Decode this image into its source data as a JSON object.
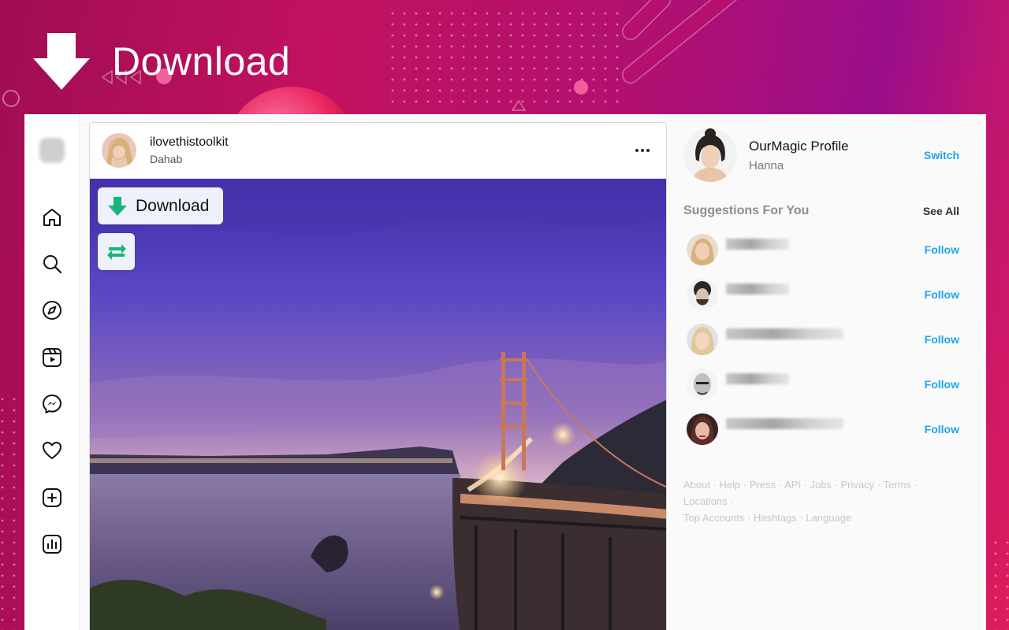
{
  "hero": {
    "title": "Download"
  },
  "sidebar": {
    "items": [
      {
        "name": "home-icon"
      },
      {
        "name": "search-icon"
      },
      {
        "name": "explore-icon"
      },
      {
        "name": "reels-icon"
      },
      {
        "name": "messenger-icon"
      },
      {
        "name": "heart-icon"
      },
      {
        "name": "create-icon"
      },
      {
        "name": "insights-icon"
      }
    ]
  },
  "post": {
    "username": "ilovethistoolkit",
    "location": "Dahab",
    "download_label": "Download"
  },
  "profile": {
    "name": "OurMagic Profile",
    "sub": "Hanna",
    "switch_label": "Switch"
  },
  "suggestions": {
    "title": "Suggestions For You",
    "see_all": "See All",
    "follow_label": "Follow",
    "items": [
      {
        "follow": "Follow"
      },
      {
        "follow": "Follow"
      },
      {
        "follow": "Follow"
      },
      {
        "follow": "Follow"
      },
      {
        "follow": "Follow"
      }
    ]
  },
  "footer": {
    "links": [
      "About",
      "Help",
      "Press",
      "API",
      "Jobs",
      "Privacy",
      "Terms",
      "Locations",
      "Top Accounts",
      "Hashtags",
      "Language"
    ],
    "separator": " · "
  },
  "colors": {
    "accent_follow": "#1fa5e8",
    "download_arrow": "#16b67a",
    "background_magenta": "#c2125f"
  }
}
